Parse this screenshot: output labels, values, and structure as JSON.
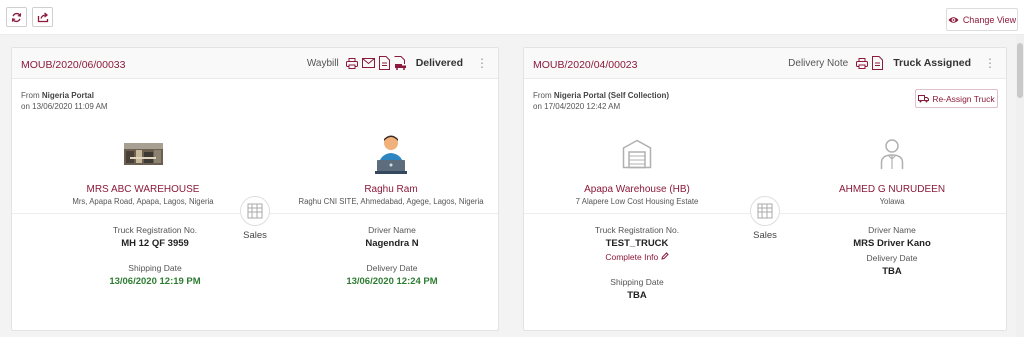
{
  "toolbar": {
    "change_view_label": "Change View",
    "accent": "#8b1a3b"
  },
  "cards": [
    {
      "order_id": "MOUB/2020/06/00033",
      "doc_label": "Waybill",
      "status": "Delivered",
      "from_prefix": "From",
      "from_source": "Nigeria Portal",
      "from_date": "on 13/06/2020 11:09 AM",
      "origin": {
        "name": "MRS ABC WAREHOUSE",
        "address": "Mrs, Apapa Road, Apapa, Lagos, Nigeria",
        "icon": "warehouse-photo"
      },
      "destination": {
        "name": "Raghu Ram",
        "address": "Raghu CNI SITE, Ahmedabad, Agege, Lagos, Nigeria",
        "icon": "person-laptop-icon"
      },
      "type_label": "Sales",
      "truck_label": "Truck Registration No.",
      "truck_value": "MH 12 QF 3959",
      "driver_label": "Driver Name",
      "driver_value": "Nagendra N",
      "shipping_label": "Shipping Date",
      "shipping_value": "13/06/2020 12:19 PM",
      "delivery_label": "Delivery Date",
      "delivery_value": "13/06/2020 12:24 PM"
    },
    {
      "order_id": "MOUB/2020/04/00023",
      "doc_label": "Delivery Note",
      "status": "Truck Assigned",
      "from_prefix": "From",
      "from_source": "Nigeria Portal (Self Collection)",
      "from_date": "on 17/04/2020 12:42 AM",
      "reassign_label": "Re-Assign Truck",
      "origin": {
        "name": "Apapa Warehouse (HB)",
        "address": "7 Alapere Low Cost Housing Estate",
        "icon": "warehouse-icon"
      },
      "destination": {
        "name": "AHMED G NURUDEEN",
        "address": "Yolawa",
        "icon": "person-icon"
      },
      "type_label": "Sales",
      "truck_label": "Truck Registration No.",
      "truck_value": "TEST_TRUCK",
      "complete_info_label": "Complete Info",
      "driver_label": "Driver Name",
      "driver_value": "MRS Driver Kano",
      "shipping_label": "Shipping Date",
      "shipping_value": "TBA",
      "delivery_label": "Delivery Date",
      "delivery_value": "TBA"
    }
  ]
}
